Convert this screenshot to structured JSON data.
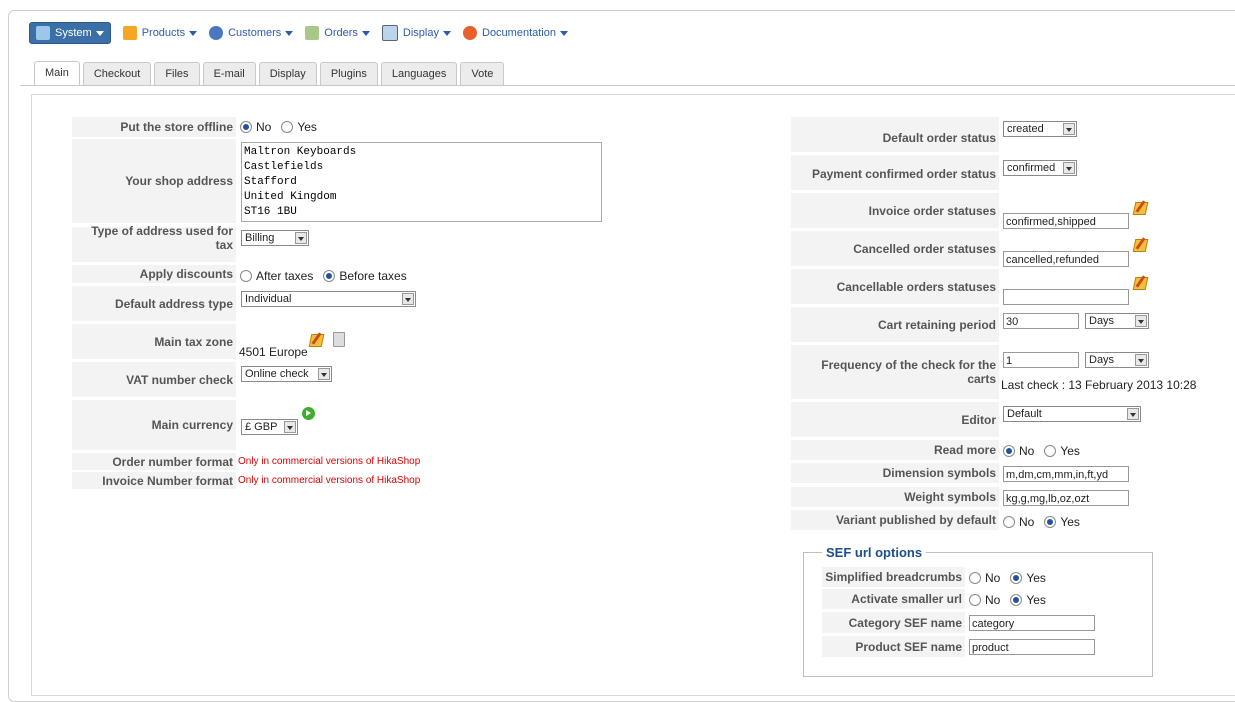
{
  "menu": [
    {
      "label": "System",
      "icon": "wrench-icon",
      "active": true
    },
    {
      "label": "Products",
      "icon": "box-icon"
    },
    {
      "label": "Customers",
      "icon": "users-icon"
    },
    {
      "label": "Orders",
      "icon": "cart-icon"
    },
    {
      "label": "Display",
      "icon": "display-icon"
    },
    {
      "label": "Documentation",
      "icon": "lifebuoy-icon"
    }
  ],
  "tabs": [
    "Main",
    "Checkout",
    "Files",
    "E-mail",
    "Display",
    "Plugins",
    "Languages",
    "Vote"
  ],
  "left": {
    "offline": {
      "label": "Put the store offline",
      "opt1": "No",
      "opt2": "Yes"
    },
    "address": {
      "label": "Your shop address",
      "value": "Maltron Keyboards\nCastlefields\nStafford\nUnited Kingdom\nST16 1BU"
    },
    "tax_addr": {
      "label": "Type of address used for tax",
      "value": "Billing"
    },
    "discounts": {
      "label": "Apply discounts",
      "opt1": "After taxes",
      "opt2": "Before taxes"
    },
    "addr_type": {
      "label": "Default address type",
      "value": "Individual"
    },
    "tax_zone": {
      "label": "Main tax zone",
      "value": "4501 Europe"
    },
    "vat": {
      "label": "VAT number check",
      "value": "Online check"
    },
    "currency": {
      "label": "Main currency",
      "value": "£ GBP"
    },
    "order_fmt": {
      "label": "Order number format",
      "value": "Only in commercial versions of HikaShop"
    },
    "invoice_fmt": {
      "label": "Invoice Number format",
      "value": "Only in commercial versions of HikaShop"
    }
  },
  "right": {
    "def_status": {
      "label": "Default order status",
      "value": "created"
    },
    "pay_status": {
      "label": "Payment confirmed order status",
      "value": "confirmed"
    },
    "invoice_status": {
      "label": "Invoice order statuses",
      "value": "confirmed,shipped"
    },
    "cancelled_status": {
      "label": "Cancelled order statuses",
      "value": "cancelled,refunded"
    },
    "cancellable_status": {
      "label": "Cancellable orders statuses",
      "value": ""
    },
    "cart_period": {
      "label": "Cart retaining period",
      "value": "30",
      "unit": "Days"
    },
    "cart_freq": {
      "label": "Frequency of the check for the carts",
      "value": "1",
      "unit": "Days",
      "last_check": "Last check : 13 February 2013 10:28"
    },
    "editor": {
      "label": "Editor",
      "value": "Default"
    },
    "read_more": {
      "label": "Read more",
      "opt1": "No",
      "opt2": "Yes"
    },
    "dimension": {
      "label": "Dimension symbols",
      "value": "m,dm,cm,mm,in,ft,yd"
    },
    "weight": {
      "label": "Weight symbols",
      "value": "kg,g,mg,lb,oz,ozt"
    },
    "variant": {
      "label": "Variant published by default",
      "opt1": "No",
      "opt2": "Yes"
    }
  },
  "sef": {
    "legend": "SEF url options",
    "breadcrumbs": {
      "label": "Simplified breadcrumbs",
      "opt1": "No",
      "opt2": "Yes"
    },
    "smaller": {
      "label": "Activate smaller url",
      "opt1": "No",
      "opt2": "Yes"
    },
    "category": {
      "label": "Category SEF name",
      "value": "category"
    },
    "product": {
      "label": "Product SEF name",
      "value": "product"
    }
  }
}
